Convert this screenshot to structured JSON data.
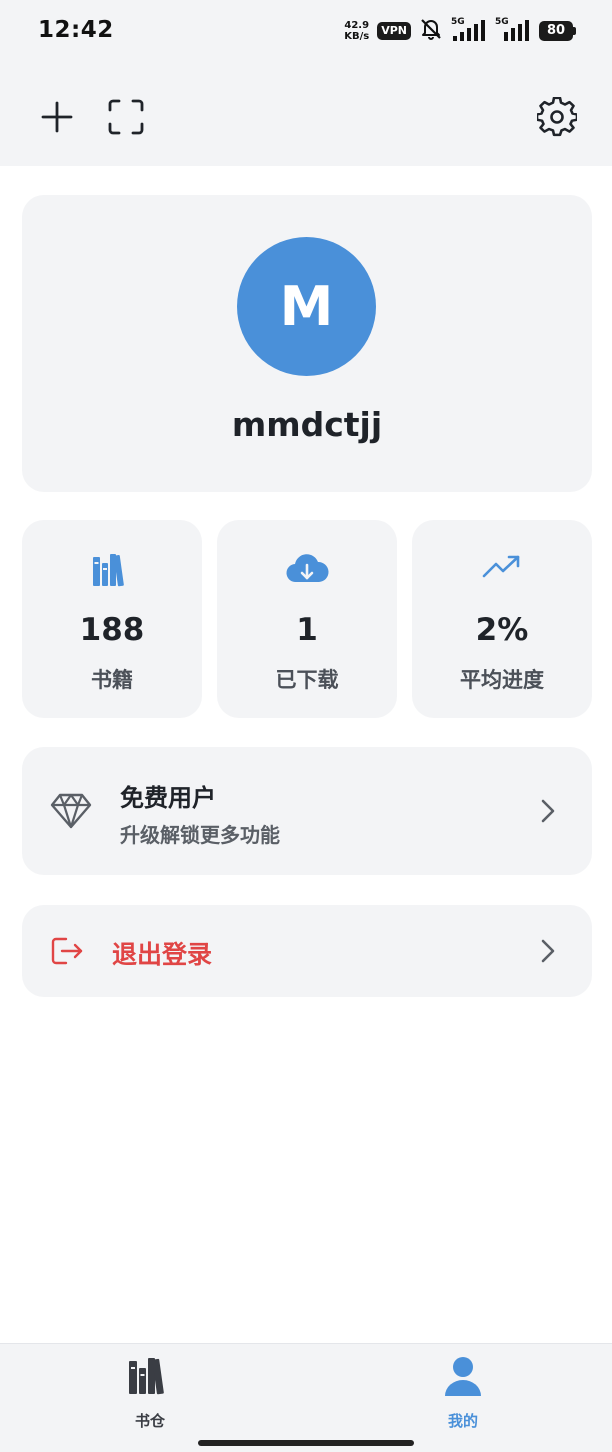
{
  "status_bar": {
    "time": "12:42",
    "net_speed_value": "42.9",
    "net_speed_unit": "KB/s",
    "vpn": "VPN",
    "signal_1_label": "5G",
    "signal_2_label": "5G",
    "battery": "80"
  },
  "toolbar": {
    "icons": [
      "plus-icon",
      "scan-icon",
      "gear-icon"
    ]
  },
  "profile": {
    "avatar_initial": "M",
    "username": "mmdctjj",
    "avatar_color": "#4a90d9"
  },
  "stats": [
    {
      "icon": "bookshelf-icon",
      "value": "188",
      "label": "书籍"
    },
    {
      "icon": "cloud-download-icon",
      "value": "1",
      "label": "已下载"
    },
    {
      "icon": "trend-up-icon",
      "value": "2%",
      "label": "平均进度"
    }
  ],
  "membership": {
    "icon": "diamond-icon",
    "title": "免费用户",
    "subtitle": "升级解锁更多功能"
  },
  "logout": {
    "icon": "logout-icon",
    "label": "退出登录",
    "color": "#e04545"
  },
  "bottom_nav": {
    "items": [
      {
        "label": "书仓",
        "icon": "bookshelf-icon",
        "active": false
      },
      {
        "label": "我的",
        "icon": "user-icon",
        "active": true
      }
    ],
    "active_color": "#4a90d9",
    "inactive_color": "#3a3d44"
  }
}
